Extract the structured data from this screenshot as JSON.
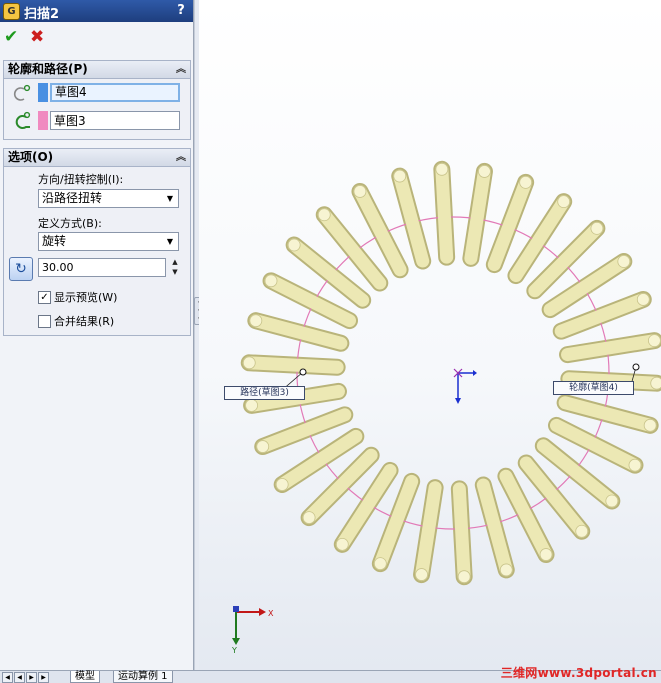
{
  "feature": {
    "title": "扫描2",
    "help": "?",
    "ok_glyph": "✔",
    "cancel_glyph": "✖"
  },
  "profile_path_group": {
    "title": "轮廓和路径(P)",
    "profile_selection": "草图4",
    "path_selection": "草图3",
    "profile_color": "#4a90e2",
    "path_color": "#f08ac0"
  },
  "options_group": {
    "title": "选项(O)",
    "orientation_label": "方向/扭转控制(I):",
    "orientation_value": "沿路径扭转",
    "define_by_label": "定义方式(B):",
    "define_by_value": "旋转",
    "twist_value": "30.00",
    "show_preview_label": "显示预览(W)",
    "show_preview_checked": true,
    "merge_result_label": "合并结果(R)",
    "merge_result_checked": false
  },
  "graphics": {
    "path_callout": "路径(草图3)",
    "profile_callout": "轮廓(草图4)",
    "triad_x": "X",
    "triad_y": "Y",
    "spring_color": "#ece8b4",
    "path_circle_color": "#e27ab7"
  },
  "bottom_tabs": {
    "model_tab": "模型",
    "motion_tab": "运动算例 1"
  },
  "watermark": "三维网www.3dportal.cn"
}
